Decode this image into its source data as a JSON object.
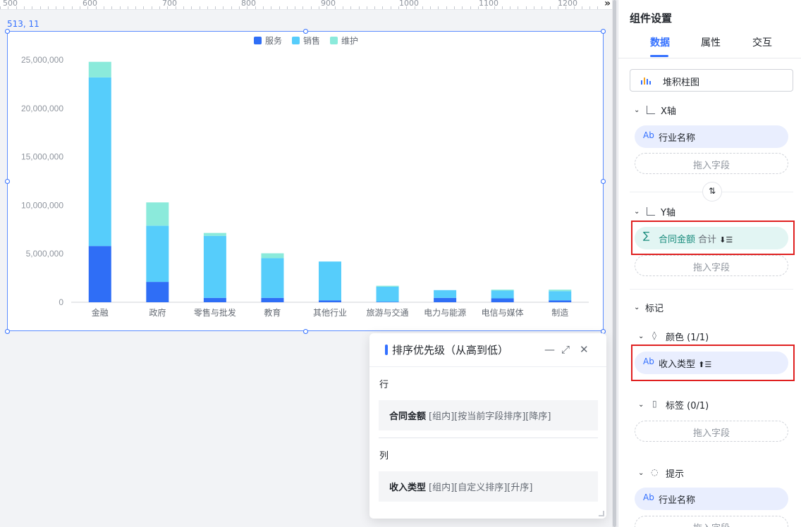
{
  "ruler": {
    "labels": [
      "500",
      "600",
      "700",
      "800",
      "900",
      "1000",
      "1100",
      "1200"
    ],
    "arrow": "»"
  },
  "canvas": {
    "coords": "513, 11"
  },
  "chart_data": {
    "type": "bar",
    "stacked": true,
    "categories": [
      "金融",
      "政府",
      "零售与批发",
      "教育",
      "其他行业",
      "旅游与交通",
      "电力与能源",
      "电信与媒体",
      "制造"
    ],
    "series": [
      {
        "name": "服务",
        "color": "#2f6ef6",
        "values": [
          5800000,
          2100000,
          450000,
          450000,
          200000,
          50000,
          450000,
          400000,
          200000
        ]
      },
      {
        "name": "销售",
        "color": "#56cdfb",
        "values": [
          17400000,
          5800000,
          6400000,
          4100000,
          4000000,
          1550000,
          800000,
          800000,
          950000
        ]
      },
      {
        "name": "维护",
        "color": "#8beadb",
        "values": [
          1600000,
          2400000,
          300000,
          500000,
          0,
          100000,
          0,
          100000,
          150000
        ]
      }
    ],
    "yticks": [
      "0",
      "5,000,000",
      "10,000,000",
      "15,000,000",
      "20,000,000",
      "25,000,000"
    ],
    "ylim": [
      0,
      25000000
    ],
    "legend_position": "top-center"
  },
  "sort_popup": {
    "title": "排序优先级（从高到低）",
    "row_section": "行",
    "row_field": "合同金额",
    "row_desc": "[组内][按当前字段排序][降序]",
    "col_section": "列",
    "col_field": "收入类型",
    "col_desc": "[组内][自定义排序][升序]",
    "minimize": "—",
    "expand": "⤢",
    "close": "✕"
  },
  "panel": {
    "title": "组件设置",
    "tabs": [
      "数据",
      "属性",
      "交互"
    ],
    "chart_type": "堆积柱图",
    "x_axis": {
      "label": "X轴",
      "field": "行业名称",
      "field_icon": "Ab",
      "drop": "拖入字段"
    },
    "swap_icon": "⇅",
    "y_axis": {
      "label": "Y轴",
      "field": "合同金额",
      "agg": "合计",
      "field_icon": "∑",
      "sort_icon": "⬇☰",
      "drop": "拖入字段"
    },
    "marks": {
      "label": "标记",
      "color": {
        "label": "颜色 (1/1)",
        "field": "收入类型",
        "field_icon": "Ab",
        "sort_icon": "⬆☰"
      },
      "tag": {
        "label": "标签 (0/1)",
        "drop": "拖入字段"
      },
      "tooltip": {
        "label": "提示",
        "field": "行业名称",
        "field_icon": "Ab",
        "drop": "拖入字段"
      }
    }
  }
}
